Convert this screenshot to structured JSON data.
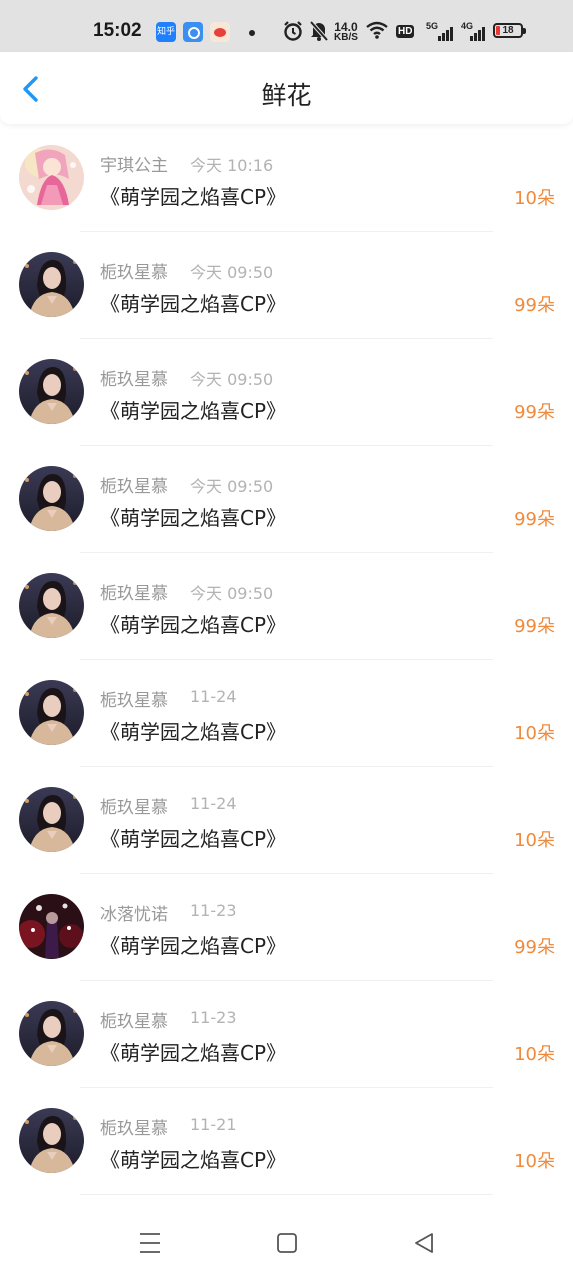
{
  "status_bar": {
    "time": "15:02",
    "app_badge_1": "知乎",
    "net_speed_value": "14.0",
    "net_speed_unit": "KB/S",
    "hd": "HD",
    "net_1": "5G",
    "net_2": "4G",
    "battery": "18",
    "icons": [
      "zhihu-icon",
      "qq-browser-icon",
      "weibo-icon",
      "notification-dot",
      "alarm-icon",
      "mute-icon",
      "wifi-icon",
      "signal-icon",
      "battery-icon"
    ]
  },
  "header": {
    "title": "鲜花",
    "back_icon": "chevron-left-icon",
    "accent_color": "#2196F3"
  },
  "colors": {
    "amount": "#f08a3c",
    "name": "#999999",
    "time": "#b3b3b3",
    "title": "#222222"
  },
  "records": [
    {
      "name": "宇琪公主",
      "time": "今天 10:16",
      "title": "《萌学园之焰喜CP》",
      "amount": "10朵",
      "avatar": "anime"
    },
    {
      "name": "栀玖星慕",
      "time": "今天 09:50",
      "title": "《萌学园之焰喜CP》",
      "amount": "99朵",
      "avatar": "girl"
    },
    {
      "name": "栀玖星慕",
      "time": "今天 09:50",
      "title": "《萌学园之焰喜CP》",
      "amount": "99朵",
      "avatar": "girl"
    },
    {
      "name": "栀玖星慕",
      "time": "今天 09:50",
      "title": "《萌学园之焰喜CP》",
      "amount": "99朵",
      "avatar": "girl"
    },
    {
      "name": "栀玖星慕",
      "time": "今天 09:50",
      "title": "《萌学园之焰喜CP》",
      "amount": "99朵",
      "avatar": "girl"
    },
    {
      "name": "栀玖星慕",
      "time": "11-24",
      "title": "《萌学园之焰喜CP》",
      "amount": "10朵",
      "avatar": "girl"
    },
    {
      "name": "栀玖星慕",
      "time": "11-24",
      "title": "《萌学园之焰喜CP》",
      "amount": "10朵",
      "avatar": "girl"
    },
    {
      "name": "冰落忧诺",
      "time": "11-23",
      "title": "《萌学园之焰喜CP》",
      "amount": "99朵",
      "avatar": "dark"
    },
    {
      "name": "栀玖星慕",
      "time": "11-23",
      "title": "《萌学园之焰喜CP》",
      "amount": "10朵",
      "avatar": "girl"
    },
    {
      "name": "栀玖星慕",
      "time": "11-21",
      "title": "《萌学园之焰喜CP》",
      "amount": "10朵",
      "avatar": "girl"
    }
  ],
  "system_nav": {
    "menu_icon": "menu-icon",
    "home_icon": "home-square-icon",
    "back_icon": "back-triangle-icon"
  }
}
